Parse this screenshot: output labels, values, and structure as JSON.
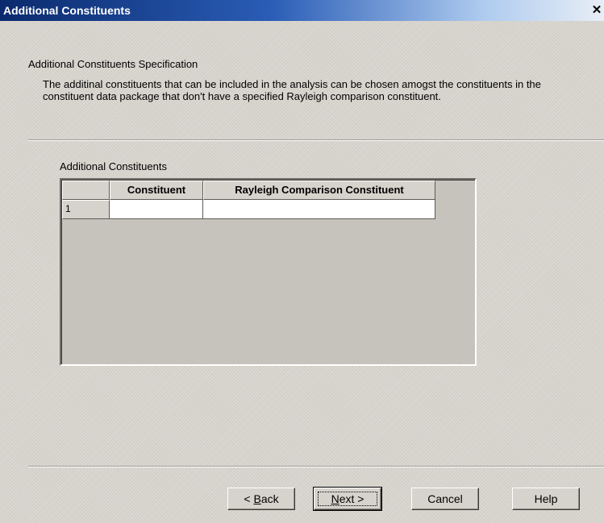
{
  "window": {
    "title": "Additional Constituents",
    "close_label": "✕"
  },
  "section": {
    "title": "Additional Constituents Specification",
    "description": "The additinal constituents that can be included in the analysis can be chosen amogst the constituents in the constituent data package that don't have a specified Rayleigh comparison constituent."
  },
  "grid": {
    "label": "Additional Constituents",
    "columns": [
      "",
      "Constituent",
      "Rayleigh Comparison Constituent"
    ],
    "rows": [
      {
        "index": "1",
        "constituent": "",
        "rayleigh_comparison_constituent": ""
      }
    ]
  },
  "buttons": {
    "back": {
      "prefix": "< ",
      "accel": "B",
      "rest": "ack"
    },
    "next": {
      "accel": "N",
      "rest": "ext >"
    },
    "cancel": "Cancel",
    "help": "Help"
  },
  "colors": {
    "titlebar_start": "#0b2a6e",
    "titlebar_end": "#e8eef6",
    "dialog_bg": "#d9d6cf"
  }
}
